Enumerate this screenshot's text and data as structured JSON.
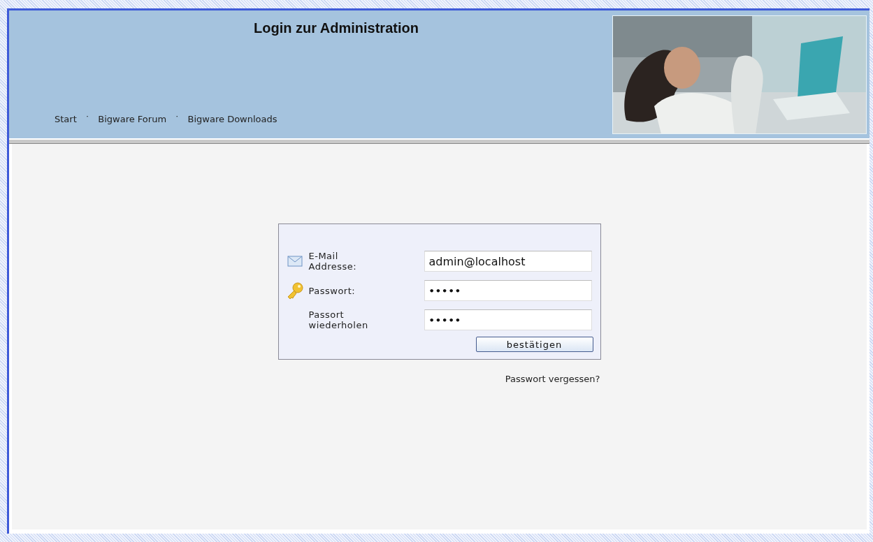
{
  "header": {
    "title": "Login zur Administration",
    "nav": [
      {
        "label": "Start"
      },
      {
        "label": "Bigware Forum"
      },
      {
        "label": "Bigware Downloads"
      }
    ],
    "separator": "˙"
  },
  "login": {
    "fields": [
      {
        "label": "E-Mail Addresse:",
        "kind": "email",
        "value": "admin@localhost"
      },
      {
        "label": "Passwort:",
        "kind": "password",
        "value": "•••••"
      },
      {
        "label": "Passort wiederholen",
        "kind": "repeat",
        "value": "•••••"
      }
    ],
    "submit": "bestätigen",
    "forgot": "Passwort vergessen?"
  }
}
